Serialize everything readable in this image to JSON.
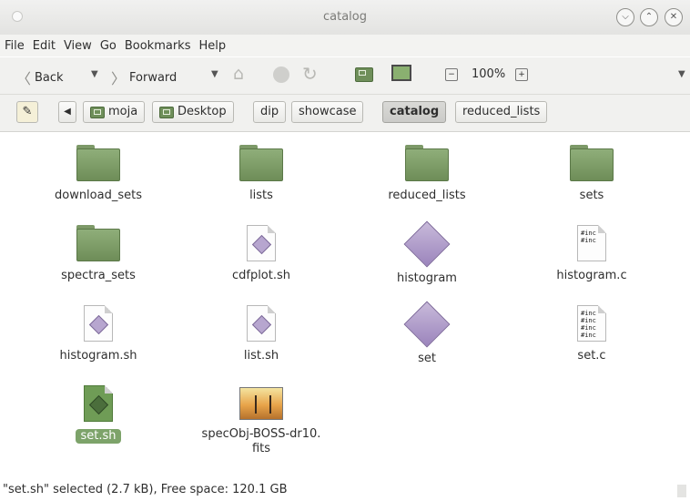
{
  "window": {
    "title": "catalog"
  },
  "menu": [
    "File",
    "Edit",
    "View",
    "Go",
    "Bookmarks",
    "Help"
  ],
  "toolbar": {
    "back_label": "Back",
    "forward_label": "Forward",
    "zoom": "100%"
  },
  "breadcrumbs": [
    "moja",
    "Desktop",
    "dip",
    "showcase",
    "catalog",
    "reduced_lists"
  ],
  "files": {
    "f0": "download_sets",
    "f1": "lists",
    "f2": "reduced_lists",
    "f3": "sets",
    "f4": "spectra_sets",
    "f5": "cdfplot.sh",
    "f6": "histogram",
    "f7": "histogram.c",
    "f8": "histogram.sh",
    "f9": "list.sh",
    "f10": "set",
    "f11": "set.c",
    "f12": "set.sh",
    "f13a": "specObj-BOSS-dr10.",
    "f13b": "fits"
  },
  "code_preview": {
    "line": "#inc"
  },
  "status": {
    "text": "\"set.sh\" selected (2.7 kB), Free space: 120.1 GB"
  },
  "colors": {
    "selection": "#7da36a",
    "folder": "#7f9e6a"
  }
}
